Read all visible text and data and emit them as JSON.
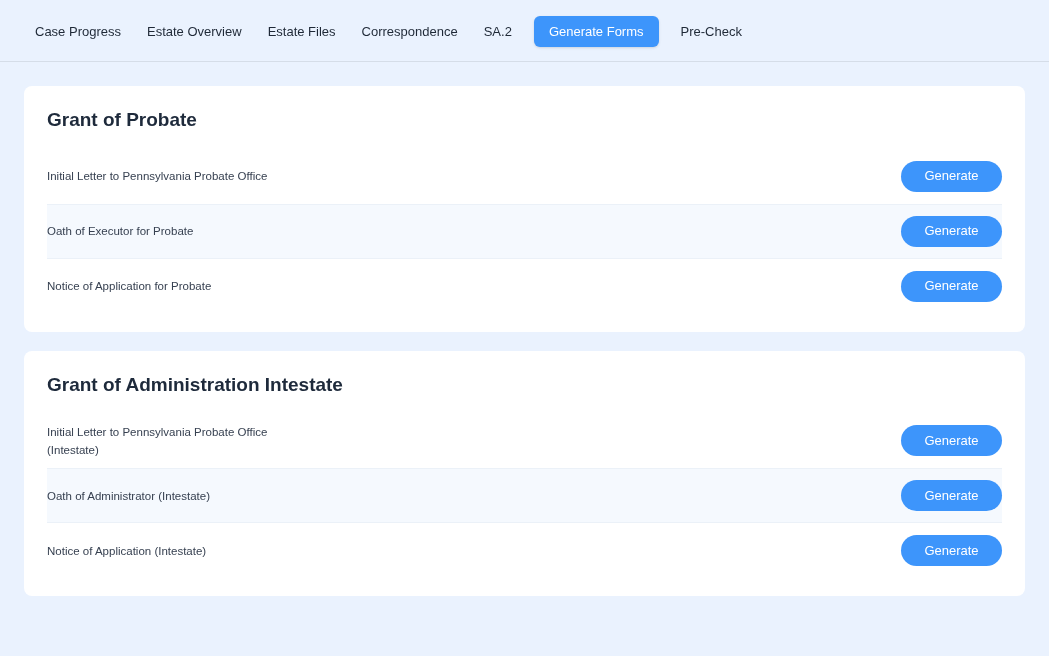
{
  "tabs": [
    {
      "label": "Case Progress",
      "selected": false
    },
    {
      "label": "Estate Overview",
      "selected": false
    },
    {
      "label": "Estate Files",
      "selected": false
    },
    {
      "label": "Correspondence",
      "selected": false
    },
    {
      "label": "SA.2",
      "selected": false
    },
    {
      "label": "Generate Forms",
      "selected": true
    },
    {
      "label": "Pre-Check",
      "selected": false
    }
  ],
  "sections": [
    {
      "title": "Grant of Probate",
      "forms": [
        {
          "name": "Initial Letter to Pennsylvania Probate Office",
          "button": "Generate"
        },
        {
          "name": "Oath of Executor for Probate",
          "button": "Generate"
        },
        {
          "name": "Notice of Application for Probate",
          "button": "Generate"
        }
      ]
    },
    {
      "title": "Grant of Administration Intestate",
      "forms": [
        {
          "name": "Initial Letter to Pennsylvania Probate Office (Intestate)",
          "button": "Generate"
        },
        {
          "name": "Oath of Administrator (Intestate)",
          "button": "Generate"
        },
        {
          "name": "Notice of Application (Intestate)",
          "button": "Generate"
        }
      ]
    }
  ]
}
